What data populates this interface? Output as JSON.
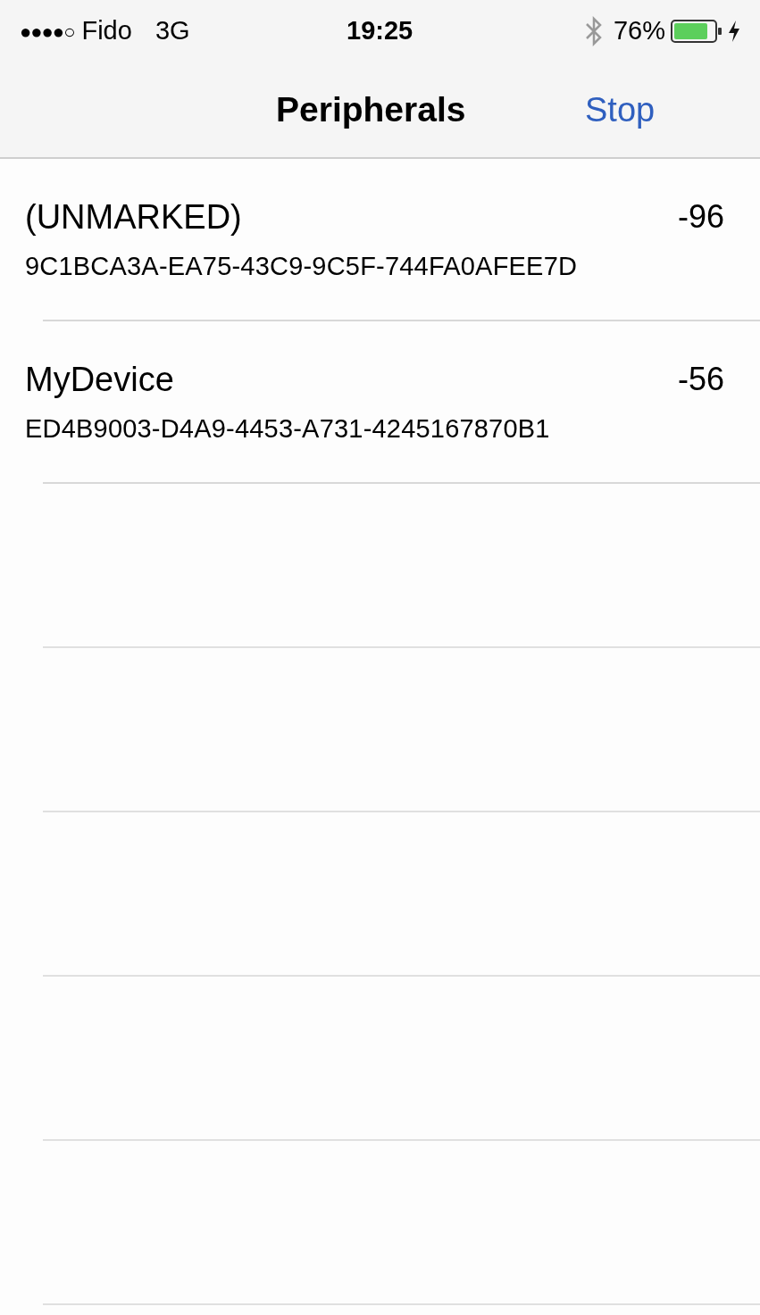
{
  "status_bar": {
    "signal": "●●●●○",
    "carrier": "Fido",
    "network": "3G",
    "time": "19:25",
    "battery": "76%"
  },
  "nav_bar": {
    "title": "Peripherals",
    "action": "Stop"
  },
  "peripherals": [
    {
      "name": "(UNMARKED)",
      "rssi": "-96",
      "uuid": "9C1BCA3A-EA75-43C9-9C5F-744FA0AFEE7D"
    },
    {
      "name": "MyDevice",
      "rssi": "-56",
      "uuid": "ED4B9003-D4A9-4453-A731-4245167870B1"
    }
  ]
}
